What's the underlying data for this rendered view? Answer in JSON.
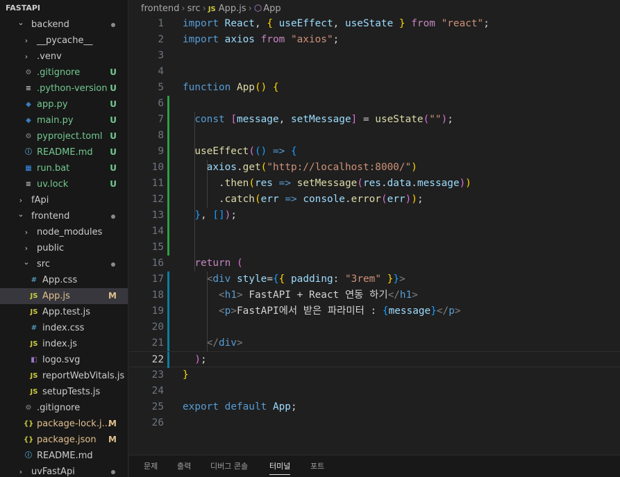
{
  "explorer": {
    "title": "FASTAPI",
    "items": [
      {
        "label": "backend",
        "kind": "folder",
        "open": true,
        "depth": 1,
        "dot": true
      },
      {
        "label": "__pycache__",
        "kind": "folder",
        "open": false,
        "depth": 2
      },
      {
        "label": ".venv",
        "kind": "folder",
        "open": false,
        "depth": 2
      },
      {
        "label": ".gitignore",
        "kind": "file",
        "icon": "gear-icon",
        "depth": 2,
        "badge": "U"
      },
      {
        "label": ".python-version",
        "kind": "file",
        "icon": "lines-icon",
        "depth": 2,
        "badge": "U"
      },
      {
        "label": "app.py",
        "kind": "file",
        "icon": "python-icon",
        "depth": 2,
        "badge": "U"
      },
      {
        "label": "main.py",
        "kind": "file",
        "icon": "python-icon",
        "depth": 2,
        "badge": "U"
      },
      {
        "label": "pyproject.toml",
        "kind": "file",
        "icon": "gear-icon",
        "depth": 2,
        "badge": "U"
      },
      {
        "label": "README.md",
        "kind": "file",
        "icon": "info-icon",
        "depth": 2,
        "badge": "U"
      },
      {
        "label": "run.bat",
        "kind": "file",
        "icon": "windows-icon",
        "depth": 2,
        "badge": "U"
      },
      {
        "label": "uv.lock",
        "kind": "file",
        "icon": "lines-icon",
        "depth": 2,
        "badge": "U"
      },
      {
        "label": "fApi",
        "kind": "folder",
        "open": false,
        "depth": 1
      },
      {
        "label": "frontend",
        "kind": "folder",
        "open": true,
        "depth": 1,
        "dot": true
      },
      {
        "label": "node_modules",
        "kind": "folder",
        "open": false,
        "depth": 2
      },
      {
        "label": "public",
        "kind": "folder",
        "open": false,
        "depth": 2
      },
      {
        "label": "src",
        "kind": "folder",
        "open": true,
        "depth": 2,
        "dot": true
      },
      {
        "label": "App.css",
        "kind": "file",
        "icon": "css-icon",
        "depth": 3
      },
      {
        "label": "App.js",
        "kind": "file",
        "icon": "js-icon",
        "depth": 3,
        "badge": "M",
        "selected": true
      },
      {
        "label": "App.test.js",
        "kind": "file",
        "icon": "js-icon",
        "depth": 3
      },
      {
        "label": "index.css",
        "kind": "file",
        "icon": "css-icon",
        "depth": 3
      },
      {
        "label": "index.js",
        "kind": "file",
        "icon": "js-icon",
        "depth": 3
      },
      {
        "label": "logo.svg",
        "kind": "file",
        "icon": "svg-icon",
        "depth": 3
      },
      {
        "label": "reportWebVitals.js",
        "kind": "file",
        "icon": "js-icon",
        "depth": 3
      },
      {
        "label": "setupTests.js",
        "kind": "file",
        "icon": "js-icon",
        "depth": 3
      },
      {
        "label": ".gitignore",
        "kind": "file",
        "icon": "gear-icon",
        "depth": 2
      },
      {
        "label": "package-lock.j...",
        "kind": "file",
        "icon": "json-icon",
        "depth": 2,
        "badge": "M"
      },
      {
        "label": "package.json",
        "kind": "file",
        "icon": "json-icon",
        "depth": 2,
        "badge": "M"
      },
      {
        "label": "README.md",
        "kind": "file",
        "icon": "info-icon",
        "depth": 2
      },
      {
        "label": "uvFastApi",
        "kind": "folder",
        "open": false,
        "depth": 1,
        "dot": true
      }
    ]
  },
  "breadcrumb": {
    "parts": [
      "frontend",
      "src",
      "App.js",
      "App"
    ]
  },
  "editor": {
    "current_line": 22,
    "lines": [
      [
        [
          "kw",
          "import "
        ],
        [
          "var",
          "React"
        ],
        [
          "op",
          ", "
        ],
        [
          "br1",
          "{ "
        ],
        [
          "var",
          "useEffect"
        ],
        [
          "op",
          ", "
        ],
        [
          "var",
          "useState"
        ],
        [
          "br1",
          " }"
        ],
        [
          "ctl",
          " from "
        ],
        [
          "str",
          "\"react\""
        ],
        [
          "op",
          ";"
        ]
      ],
      [
        [
          "kw",
          "import "
        ],
        [
          "var",
          "axios"
        ],
        [
          "ctl",
          " from "
        ],
        [
          "str",
          "\"axios\""
        ],
        [
          "op",
          ";"
        ]
      ],
      [],
      [],
      [
        [
          "kw",
          "function "
        ],
        [
          "fn",
          "App"
        ],
        [
          "br1",
          "() {"
        ]
      ],
      [],
      [
        [
          "op",
          "  "
        ],
        [
          "kw",
          "const "
        ],
        [
          "br2",
          "["
        ],
        [
          "var",
          "message"
        ],
        [
          "op",
          ", "
        ],
        [
          "var",
          "setMessage"
        ],
        [
          "br2",
          "]"
        ],
        [
          "op",
          " = "
        ],
        [
          "fn",
          "useState"
        ],
        [
          "br2",
          "("
        ],
        [
          "str",
          "\"\""
        ],
        [
          "br2",
          ")"
        ],
        [
          "op",
          ";"
        ]
      ],
      [],
      [
        [
          "op",
          "  "
        ],
        [
          "fn",
          "useEffect"
        ],
        [
          "br2",
          "("
        ],
        [
          "br3",
          "()"
        ],
        [
          "op",
          " "
        ],
        [
          "kw",
          "=>"
        ],
        [
          "op",
          " "
        ],
        [
          "br3",
          "{"
        ]
      ],
      [
        [
          "op",
          "    "
        ],
        [
          "var",
          "axios"
        ],
        [
          "op",
          "."
        ],
        [
          "fn",
          "get"
        ],
        [
          "br1",
          "("
        ],
        [
          "str",
          "\"http://localhost:8000/\""
        ],
        [
          "br1",
          ")"
        ]
      ],
      [
        [
          "op",
          "      ."
        ],
        [
          "fn",
          "then"
        ],
        [
          "br1",
          "("
        ],
        [
          "var",
          "res"
        ],
        [
          "op",
          " "
        ],
        [
          "kw",
          "=>"
        ],
        [
          "op",
          " "
        ],
        [
          "fn",
          "setMessage"
        ],
        [
          "br2",
          "("
        ],
        [
          "var",
          "res"
        ],
        [
          "op",
          "."
        ],
        [
          "var",
          "data"
        ],
        [
          "op",
          "."
        ],
        [
          "var",
          "message"
        ],
        [
          "br2",
          ")"
        ],
        [
          "br1",
          ")"
        ]
      ],
      [
        [
          "op",
          "      ."
        ],
        [
          "fn",
          "catch"
        ],
        [
          "br1",
          "("
        ],
        [
          "var",
          "err"
        ],
        [
          "op",
          " "
        ],
        [
          "kw",
          "=>"
        ],
        [
          "op",
          " "
        ],
        [
          "var",
          "console"
        ],
        [
          "op",
          "."
        ],
        [
          "fn",
          "error"
        ],
        [
          "br2",
          "("
        ],
        [
          "var",
          "err"
        ],
        [
          "br2",
          ")"
        ],
        [
          "br1",
          ")"
        ],
        [
          "op",
          ";"
        ]
      ],
      [
        [
          "op",
          "  "
        ],
        [
          "br3",
          "}"
        ],
        [
          "op",
          ", "
        ],
        [
          "br3",
          "[]"
        ],
        [
          "br2",
          ")"
        ],
        [
          "op",
          ";"
        ]
      ],
      [],
      [],
      [
        [
          "op",
          "  "
        ],
        [
          "ctl",
          "return "
        ],
        [
          "br2",
          "("
        ]
      ],
      [
        [
          "op",
          "    "
        ],
        [
          "ang",
          "<"
        ],
        [
          "tag",
          "div"
        ],
        [
          "op",
          " "
        ],
        [
          "var",
          "style"
        ],
        [
          "op",
          "="
        ],
        [
          "br3",
          "{"
        ],
        [
          "br1",
          "{"
        ],
        [
          "op",
          " "
        ],
        [
          "var",
          "padding"
        ],
        [
          "op",
          ": "
        ],
        [
          "str",
          "\"3rem\""
        ],
        [
          "op",
          " "
        ],
        [
          "br1",
          "}"
        ],
        [
          "br3",
          "}"
        ],
        [
          "ang",
          ">"
        ]
      ],
      [
        [
          "op",
          "      "
        ],
        [
          "ang",
          "<"
        ],
        [
          "tag",
          "h1"
        ],
        [
          "ang",
          ">"
        ],
        [
          "txt",
          " FastAPI + React 연동 하기"
        ],
        [
          "ang",
          "</"
        ],
        [
          "tag",
          "h1"
        ],
        [
          "ang",
          ">"
        ]
      ],
      [
        [
          "op",
          "      "
        ],
        [
          "ang",
          "<"
        ],
        [
          "tag",
          "p"
        ],
        [
          "ang",
          ">"
        ],
        [
          "txt",
          "FastAPI에서 받은 파라미터 : "
        ],
        [
          "br3",
          "{"
        ],
        [
          "var",
          "message"
        ],
        [
          "br3",
          "}"
        ],
        [
          "ang",
          "</"
        ],
        [
          "tag",
          "p"
        ],
        [
          "ang",
          ">"
        ]
      ],
      [],
      [
        [
          "op",
          "    "
        ],
        [
          "ang",
          "</"
        ],
        [
          "tag",
          "div"
        ],
        [
          "ang",
          ">"
        ]
      ],
      [
        [
          "op",
          "  "
        ],
        [
          "br2",
          ")"
        ],
        [
          "op",
          ";"
        ]
      ],
      [
        [
          "br1",
          "}"
        ]
      ],
      [],
      [
        [
          "kw",
          "export "
        ],
        [
          "kw",
          "default "
        ],
        [
          "var",
          "App"
        ],
        [
          "op",
          ";"
        ]
      ],
      []
    ],
    "gutter_added": [
      6,
      7,
      8,
      9,
      10,
      11,
      12,
      13,
      14,
      15
    ],
    "gutter_modified": [
      17,
      18,
      19,
      20,
      21,
      22
    ]
  },
  "panel": {
    "tabs": [
      "문제",
      "출력",
      "디버그 콘솔",
      "터미널",
      "포트"
    ],
    "active": "터미널"
  },
  "colors": {
    "accent_added": "#2ea043",
    "accent_modified": "#0c7d9d",
    "badge_u": "#73c991",
    "badge_m": "#e2c08d"
  }
}
